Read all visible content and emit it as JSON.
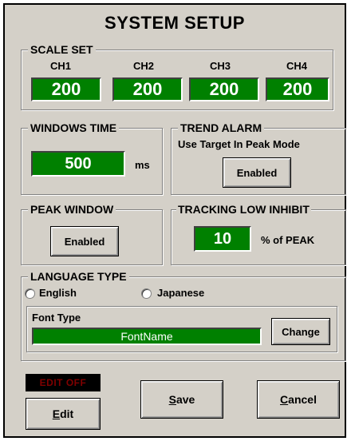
{
  "title": "SYSTEM  SETUP",
  "scale_set": {
    "legend": "SCALE SET",
    "channels": [
      {
        "label": "CH1",
        "value": "200"
      },
      {
        "label": "CH2",
        "value": "200"
      },
      {
        "label": "CH3",
        "value": "200"
      },
      {
        "label": "CH4",
        "value": "200"
      }
    ]
  },
  "windows_time": {
    "legend": "WINDOWS TIME",
    "value": "500",
    "unit": "ms"
  },
  "trend_alarm": {
    "legend": "TREND ALARM",
    "caption": "Use Target In Peak Mode",
    "button": "Enabled"
  },
  "peak_window": {
    "legend": "PEAK WINDOW",
    "button": "Enabled"
  },
  "tracking_low_inhibit": {
    "legend": "TRACKING LOW INHIBIT",
    "value": "10",
    "unit": "% of PEAK"
  },
  "language_type": {
    "legend": "LANGUAGE TYPE",
    "options": [
      "English",
      "Japanese"
    ],
    "font_type_label": "Font Type",
    "font_name": "FontName",
    "change_button": "Change"
  },
  "edit_status": "EDIT OFF",
  "buttons": {
    "edit": {
      "mnemonic": "E",
      "rest": "dit"
    },
    "save": {
      "mnemonic": "S",
      "rest": "ave"
    },
    "cancel": {
      "mnemonic": "C",
      "rest": "ancel"
    }
  },
  "colors": {
    "panel": "#d4d0c8",
    "display_green": "#008000",
    "edit_off_text": "#800000"
  }
}
